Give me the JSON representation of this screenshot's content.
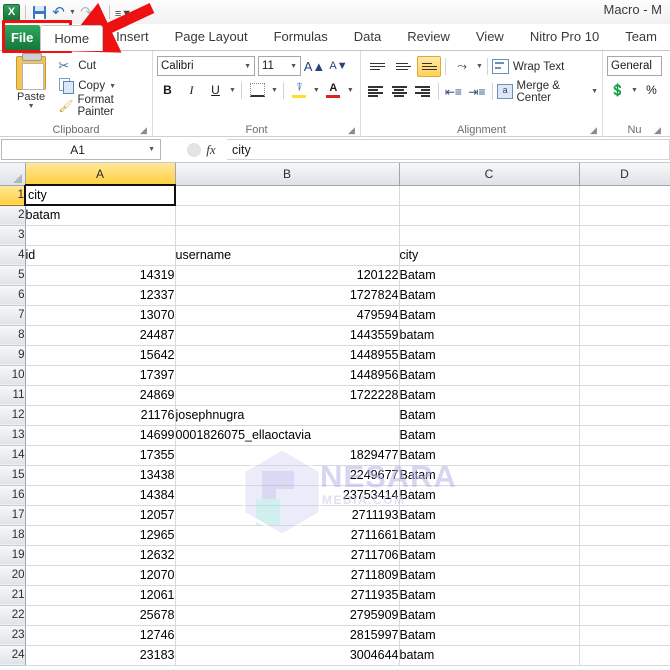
{
  "window": {
    "title": "Macro - M",
    "app_icon": "excel-logo-icon"
  },
  "quick_access": {
    "save": "save-icon",
    "undo": "undo-icon",
    "redo": "redo-icon",
    "customize": "customize-qat-icon"
  },
  "ribbon": {
    "file_tab": "File",
    "tabs": [
      {
        "label": "Home",
        "active": true
      },
      {
        "label": "Insert",
        "active": false
      },
      {
        "label": "Page Layout",
        "active": false
      },
      {
        "label": "Formulas",
        "active": false
      },
      {
        "label": "Data",
        "active": false
      },
      {
        "label": "Review",
        "active": false
      },
      {
        "label": "View",
        "active": false
      },
      {
        "label": "Nitro Pro 10",
        "active": false
      },
      {
        "label": "Team",
        "active": false
      }
    ],
    "groups": {
      "clipboard": {
        "label": "Clipboard",
        "paste": "Paste",
        "cut": "Cut",
        "copy": "Copy",
        "format_painter": "Format Painter"
      },
      "font": {
        "label": "Font",
        "font_name": "Calibri",
        "font_size": "11",
        "bold": "B",
        "italic": "I",
        "underline": "U",
        "fill_color": "#ffdf2b",
        "font_color": "#e02020"
      },
      "alignment": {
        "label": "Alignment",
        "wrap_text": "Wrap Text",
        "merge_center": "Merge & Center"
      },
      "number": {
        "label": "Nu",
        "format": "General"
      }
    }
  },
  "formula_bar": {
    "name_box": "A1",
    "formula": "city"
  },
  "sheet": {
    "columns": [
      "A",
      "B",
      "C",
      "D"
    ],
    "selected_column": "A",
    "selected_cell": "A1",
    "rows": [
      {
        "n": "1",
        "a": "city",
        "b": "",
        "c": "",
        "a_align": "txt",
        "b_align": "txt"
      },
      {
        "n": "2",
        "a": "batam",
        "b": "",
        "c": "",
        "a_align": "txt",
        "b_align": "txt"
      },
      {
        "n": "3",
        "a": "",
        "b": "",
        "c": "",
        "a_align": "txt",
        "b_align": "txt"
      },
      {
        "n": "4",
        "a": "id",
        "b": "username",
        "c": "city",
        "a_align": "txt",
        "b_align": "txt"
      },
      {
        "n": "5",
        "a": "14319",
        "b": "120122",
        "c": "Batam",
        "a_align": "num",
        "b_align": "num"
      },
      {
        "n": "6",
        "a": "12337",
        "b": "1727824",
        "c": "Batam",
        "a_align": "num",
        "b_align": "num"
      },
      {
        "n": "7",
        "a": "13070",
        "b": "479594",
        "c": "Batam",
        "a_align": "num",
        "b_align": "num"
      },
      {
        "n": "8",
        "a": "24487",
        "b": "1443559",
        "c": "batam",
        "a_align": "num",
        "b_align": "num"
      },
      {
        "n": "9",
        "a": "15642",
        "b": "1448955",
        "c": "Batam",
        "a_align": "num",
        "b_align": "num"
      },
      {
        "n": "10",
        "a": "17397",
        "b": "1448956",
        "c": "Batam",
        "a_align": "num",
        "b_align": "num"
      },
      {
        "n": "11",
        "a": "24869",
        "b": "1722228",
        "c": "Batam",
        "a_align": "num",
        "b_align": "num"
      },
      {
        "n": "12",
        "a": "21176",
        "b": "josephnugra",
        "c": "Batam",
        "a_align": "num",
        "b_align": "txt"
      },
      {
        "n": "13",
        "a": "14699",
        "b": "0001826075_ellaoctavia",
        "c": "Batam",
        "a_align": "num",
        "b_align": "txt"
      },
      {
        "n": "14",
        "a": "17355",
        "b": "1829477",
        "c": "Batam",
        "a_align": "num",
        "b_align": "num"
      },
      {
        "n": "15",
        "a": "13438",
        "b": "2249677",
        "c": "Batam",
        "a_align": "num",
        "b_align": "num"
      },
      {
        "n": "16",
        "a": "14384",
        "b": "23753414",
        "c": "Batam",
        "a_align": "num",
        "b_align": "num"
      },
      {
        "n": "17",
        "a": "12057",
        "b": "2711193",
        "c": "Batam",
        "a_align": "num",
        "b_align": "num"
      },
      {
        "n": "18",
        "a": "12965",
        "b": "2711661",
        "c": "Batam",
        "a_align": "num",
        "b_align": "num"
      },
      {
        "n": "19",
        "a": "12632",
        "b": "2711706",
        "c": "Batam",
        "a_align": "num",
        "b_align": "num"
      },
      {
        "n": "20",
        "a": "12070",
        "b": "2711809",
        "c": "Batam",
        "a_align": "num",
        "b_align": "num"
      },
      {
        "n": "21",
        "a": "12061",
        "b": "2711935",
        "c": "Batam",
        "a_align": "num",
        "b_align": "num"
      },
      {
        "n": "22",
        "a": "25678",
        "b": "2795909",
        "c": "Batam",
        "a_align": "num",
        "b_align": "num"
      },
      {
        "n": "23",
        "a": "12746",
        "b": "2815997",
        "c": "Batam",
        "a_align": "num",
        "b_align": "num"
      },
      {
        "n": "24",
        "a": "23183",
        "b": "3004644",
        "c": "batam",
        "a_align": "num",
        "b_align": "num"
      }
    ]
  },
  "watermark": {
    "text": "NESARA",
    "subtext": "MEDIA.COM"
  },
  "annotation": {
    "highlight_color": "#ee1111",
    "target": "File"
  }
}
